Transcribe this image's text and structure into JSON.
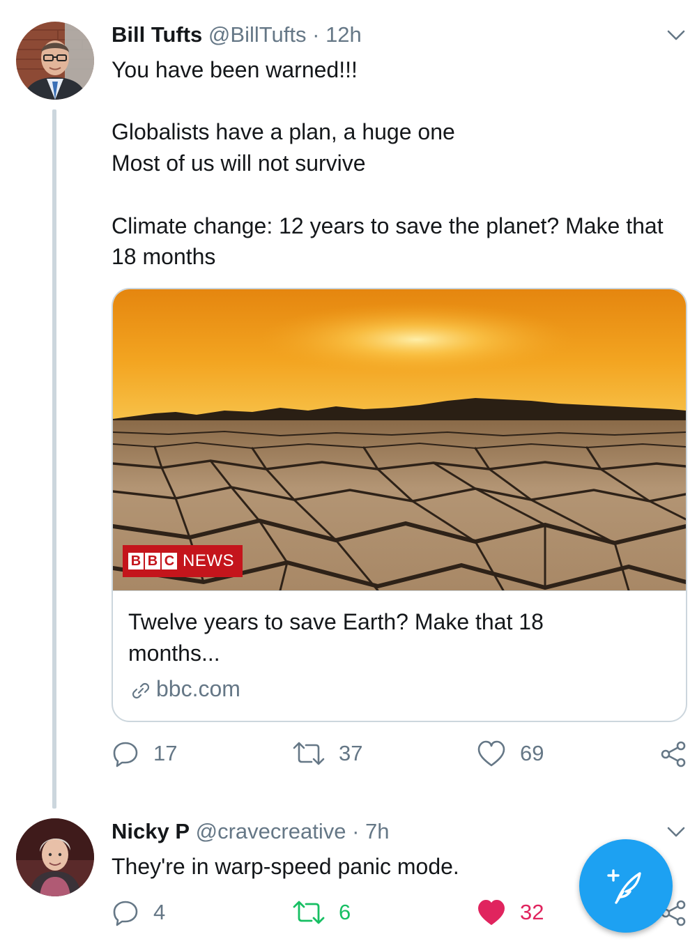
{
  "tweet1": {
    "name": "Bill Tufts",
    "handle": "@BillTufts",
    "separator": "·",
    "time": "12h",
    "text": "You have been warned!!!\n\nGlobalists have a plan, a huge one\nMost of us will not survive\n\nClimate change: 12 years to save the planet? Make that 18 months",
    "card": {
      "image_logo_box1": "B",
      "image_logo_box2": "B",
      "image_logo_box3": "C",
      "image_logo_text": "NEWS",
      "title": "Twelve years to save Earth? Make that 18 months...",
      "domain": "bbc.com"
    },
    "actions": {
      "replies": "17",
      "retweets": "37",
      "likes": "69"
    }
  },
  "tweet2": {
    "name": "Nicky P",
    "handle": "@cravecreative",
    "separator": "·",
    "time": "7h",
    "text": "They're in warp-speed panic mode.",
    "actions": {
      "replies": "4",
      "retweets": "6",
      "likes": "32"
    }
  },
  "colors": {
    "brand_blue": "#1da1f2",
    "secondary_text": "#657786",
    "retweet_active": "#17bf63",
    "like_active": "#e0245e",
    "bbc_red": "#c4151c"
  },
  "icons": [
    "chevron-down-icon",
    "reply-icon",
    "retweet-icon",
    "heart-icon",
    "share-icon",
    "link-icon",
    "compose-tweet-icon"
  ]
}
